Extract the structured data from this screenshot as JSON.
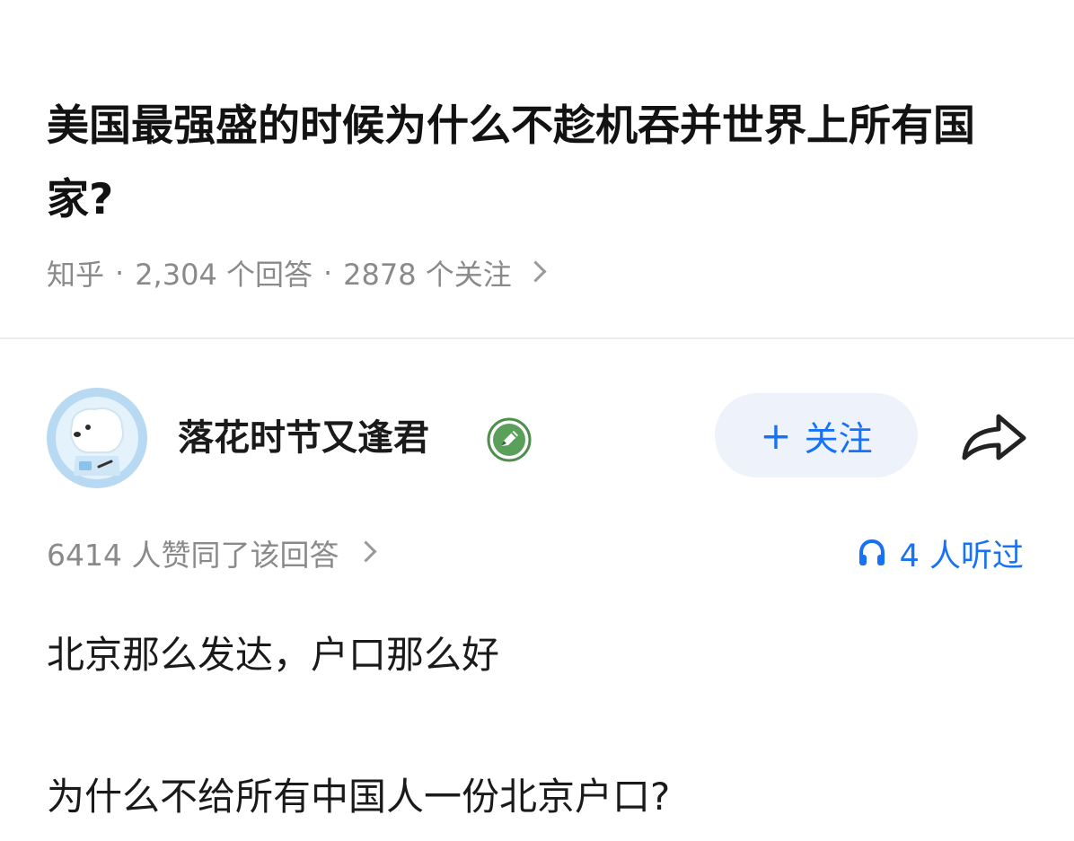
{
  "question": {
    "title": "美国最强盛的时候为什么不趁机吞并世界上所有国家?",
    "source": "知乎",
    "answers_count": "2,304 个回答",
    "followers_count": "2878 个关注"
  },
  "answer": {
    "author_name": "落花时节又逢君",
    "follow_label": "关注",
    "follow_plus": "+",
    "upvotes_text": "6414 人赞同了该回答",
    "listen_text": "4 人听过",
    "paragraphs": [
      "北京那么发达，户口那么好",
      "为什么不给所有中国人一份北京户口?"
    ]
  },
  "colors": {
    "accent": "#1772f6",
    "follow_bg": "#edf2fb",
    "badge_green": "#5aa05a",
    "meta_gray": "#8a8a8a"
  },
  "icons": {
    "avatar": "polar-bear-astronaut-avatar",
    "badge": "creator-pencil-badge-icon",
    "share": "share-arrow-icon",
    "listen": "headphones-icon",
    "chevron": "chevron-right-icon"
  }
}
